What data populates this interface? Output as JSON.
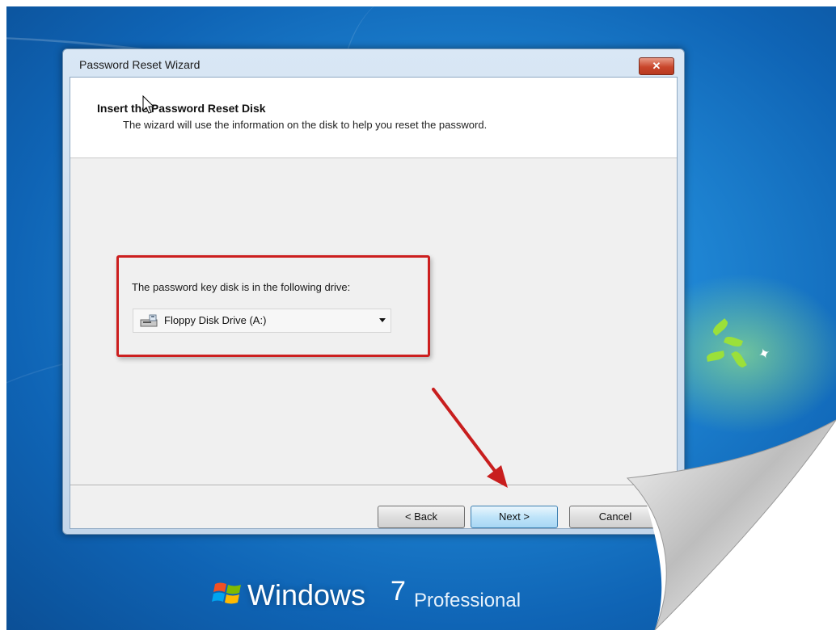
{
  "window": {
    "title": "Password Reset Wizard",
    "close_label": "✕"
  },
  "header": {
    "title": "Insert the Password Reset Disk",
    "subtitle": "The wizard will use the information on the disk to help you reset the password."
  },
  "drive": {
    "label": "The password key disk is in the following drive:",
    "selected": "Floppy Disk Drive (A:)"
  },
  "buttons": {
    "back": "< Back",
    "next": "Next >",
    "cancel": "Cancel"
  },
  "branding": {
    "windows": "Windows",
    "version": "7",
    "edition": "Professional"
  },
  "colors": {
    "highlight_box": "#cc1f1f",
    "arrow": "#c81e1e",
    "desktop": "#1f86d4"
  },
  "icons": {
    "drive": "floppy-drive-icon",
    "windows": "windows-flag-icon",
    "annotation_arrow": "red-arrow-icon",
    "cursor": "mouse-cursor-icon"
  }
}
